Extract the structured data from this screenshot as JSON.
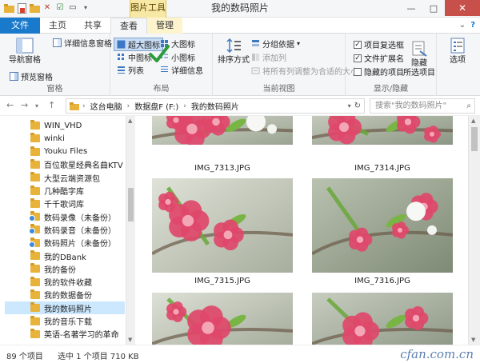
{
  "window": {
    "title": "我的数码照片",
    "context_tab_group": "图片工具",
    "controls": {
      "minimize": "—",
      "maximize": "□",
      "close": "✕"
    }
  },
  "tabs": [
    {
      "label": "文件"
    },
    {
      "label": "主页"
    },
    {
      "label": "共享"
    },
    {
      "label": "查看"
    },
    {
      "label": "管理"
    }
  ],
  "ribbon": {
    "panes": {
      "label": "窗格",
      "nav_pane": "导航窗格",
      "preview_pane": "预览窗格",
      "details_pane": "详细信息窗格"
    },
    "layout": {
      "label": "布局",
      "extra_large": "超大图标",
      "large": "大图标",
      "medium": "中图标",
      "small": "小图标",
      "list": "列表",
      "details": "详细信息"
    },
    "current_view": {
      "label": "当前视图",
      "sort_by": "排序方式",
      "group_by": "分组依据",
      "add_column": "添加列",
      "fit_columns": "将所有列调整为合适的大小"
    },
    "show_hide": {
      "label": "显示/隐藏",
      "item_checkboxes": "项目复选框",
      "file_extensions": "文件扩展名",
      "hidden_items": "隐藏的项目",
      "hide_selected": "隐藏\n所选项目",
      "options": "选项"
    }
  },
  "address": {
    "segments": [
      "这台电脑",
      "数据盘F (F:)",
      "我的数码照片"
    ],
    "search_placeholder": "搜索\"我的数码照片\""
  },
  "nav_items": [
    {
      "label": "WIN_VHD",
      "sync": false
    },
    {
      "label": "winki",
      "sync": false
    },
    {
      "label": "Youku Files",
      "sync": false
    },
    {
      "label": "百位歌星经典名曲KTV",
      "sync": false
    },
    {
      "label": "大型云端资源包",
      "sync": false
    },
    {
      "label": "几种酷字库",
      "sync": false
    },
    {
      "label": "千千歌词库",
      "sync": false
    },
    {
      "label": "数码录像（未备份）",
      "sync": true
    },
    {
      "label": "数码录音（未备份）",
      "sync": true
    },
    {
      "label": "数码照片（未备份）",
      "sync": true
    },
    {
      "label": "我的DBank",
      "sync": false
    },
    {
      "label": "我的备份",
      "sync": false
    },
    {
      "label": "我的软件收藏",
      "sync": false
    },
    {
      "label": "我的数据备份",
      "sync": false
    },
    {
      "label": "我的数码照片",
      "sync": false,
      "selected": true
    },
    {
      "label": "我的音乐下载",
      "sync": false
    },
    {
      "label": "英语-名著学习的革命",
      "sync": false
    }
  ],
  "files": [
    {
      "name": "IMG_7313.JPG"
    },
    {
      "name": "IMG_7314.JPG"
    },
    {
      "name": "IMG_7315.JPG"
    },
    {
      "name": "IMG_7316.JPG"
    },
    {
      "name": ""
    },
    {
      "name": ""
    }
  ],
  "status": {
    "item_count": "89 个项目",
    "selection": "选中 1 个项目  710 KB"
  },
  "watermark": "cfan.com.cn",
  "colors": {
    "file_tab": "#1979ca",
    "selection": "#cce8ff",
    "folder": "#e8b33b",
    "close_button": "#c7504b"
  }
}
